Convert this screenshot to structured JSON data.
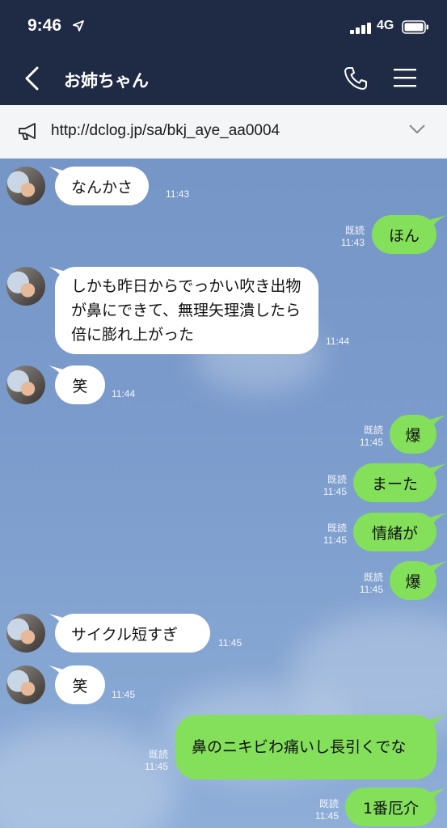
{
  "status_bar": {
    "time": "9:46",
    "network": "4G"
  },
  "header": {
    "title": "お姉ちゃん"
  },
  "notice": {
    "text": "http://dclog.jp/sa/bkj_aye_aa0004"
  },
  "messages": [
    {
      "side": "in",
      "text": "なんかさ",
      "time": "11:43"
    },
    {
      "side": "out",
      "text": "ほん",
      "read": "既読",
      "time": "11:43"
    },
    {
      "side": "in",
      "text": "しかも昨日からでっかい吹き出物が鼻にできて、無理矢理潰したら倍に膨れ上がった",
      "time": "11:44"
    },
    {
      "side": "in",
      "text": "笑",
      "time": "11:44"
    },
    {
      "side": "out",
      "text": "爆",
      "read": "既読",
      "time": "11:45"
    },
    {
      "side": "out",
      "text": "まーた",
      "read": "既読",
      "time": "11:45"
    },
    {
      "side": "out",
      "text": "情緒が",
      "read": "既読",
      "time": "11:45"
    },
    {
      "side": "out",
      "text": "爆",
      "read": "既読",
      "time": "11:45"
    },
    {
      "side": "in",
      "text": "サイクル短すぎ",
      "time": "11:45"
    },
    {
      "side": "in",
      "text": "笑",
      "time": "11:45"
    },
    {
      "side": "out",
      "text": "鼻のニキビわ痛いし長引くでな",
      "read": "既読",
      "time": "11:45"
    },
    {
      "side": "out",
      "text": "1番厄介",
      "read": "既読",
      "time": "11:45"
    }
  ]
}
